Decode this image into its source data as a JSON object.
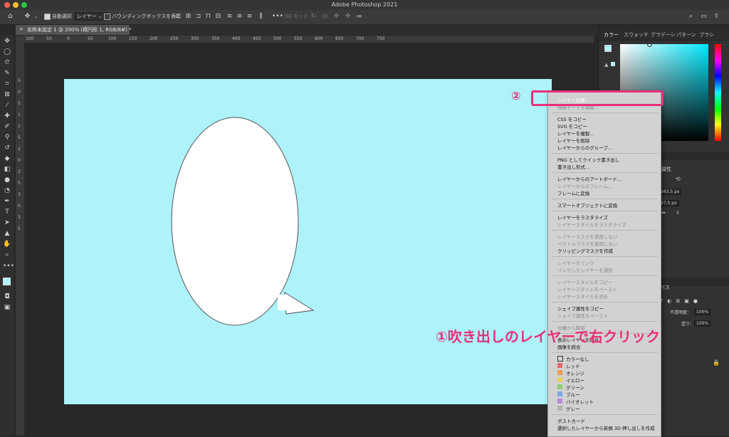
{
  "window": {
    "title": "Adobe Photoshop 2021"
  },
  "optionsbar": {
    "auto_select_label": "自動選択 :",
    "auto_select_value": "レイヤー",
    "bbox_label": "バウンディングボックスを表示",
    "mode3d_label": "3D モード :"
  },
  "document_tab": {
    "title": "名称未設定 1 @ 200% (楕円形 1, RGB/8#) *",
    "close": "×"
  },
  "ruler": {
    "h_ticks": [
      "100",
      "50",
      "0",
      "50",
      "100",
      "150",
      "200",
      "250",
      "300",
      "350",
      "400",
      "450",
      "500",
      "550",
      "600",
      "650",
      "700",
      "750"
    ],
    "v_ticks": [
      "5",
      "0",
      "5",
      "1",
      "1",
      "5",
      "2",
      "0",
      "2",
      "5",
      "3",
      "0",
      "3",
      "5"
    ]
  },
  "panels": {
    "color_tabs": [
      "カラー",
      "スウォッチ",
      "グラデーシ",
      "パターン",
      "ブラシ"
    ],
    "properties_label": "属性",
    "width_value": "263.5 px",
    "height_value": "97.5 px",
    "layers_label": "バス",
    "opacity_label": "不透明度：",
    "opacity_value": "100%",
    "fill_label": "塗り：",
    "fill_value": "100%"
  },
  "context_menu": {
    "items": [
      {
        "label": "レイヤー効果...",
        "disabled": false,
        "highlighted": true
      },
      {
        "label": "描画モードを編集...",
        "disabled": true
      },
      {
        "sep": true
      },
      {
        "label": "CSS をコピー",
        "disabled": false
      },
      {
        "label": "SVG をコピー",
        "disabled": false
      },
      {
        "label": "レイヤーを複製...",
        "disabled": false
      },
      {
        "label": "レイヤーを削除",
        "disabled": false
      },
      {
        "label": "レイヤーからのグループ...",
        "disabled": false
      },
      {
        "sep": true
      },
      {
        "label": "PNG としてクイック書き出し",
        "disabled": false
      },
      {
        "label": "書き出し形式...",
        "disabled": false
      },
      {
        "sep": true
      },
      {
        "label": "レイヤーからのアートボード...",
        "disabled": false
      },
      {
        "label": "レイヤーからのフレーム...",
        "disabled": true
      },
      {
        "label": "フレームに変換",
        "disabled": false
      },
      {
        "sep": true
      },
      {
        "label": "スマートオブジェクトに変換",
        "disabled": false
      },
      {
        "sep": true
      },
      {
        "label": "レイヤーをラスタライズ",
        "disabled": false
      },
      {
        "label": "レイヤースタイルをラスタライズ",
        "disabled": true
      },
      {
        "sep": true
      },
      {
        "label": "レイヤーマスクを使用しない",
        "disabled": true
      },
      {
        "label": "ベクトルマスクを使用しない",
        "disabled": true
      },
      {
        "label": "クリッピングマスクを作成",
        "disabled": false
      },
      {
        "sep": true
      },
      {
        "label": "レイヤーをリンク",
        "disabled": true
      },
      {
        "label": "リンクしたレイヤーを選択",
        "disabled": true
      },
      {
        "sep": true
      },
      {
        "label": "レイヤースタイルをコピー",
        "disabled": true
      },
      {
        "label": "レイヤースタイルをペースト",
        "disabled": true
      },
      {
        "label": "レイヤースタイルを消去",
        "disabled": true
      },
      {
        "sep": true
      },
      {
        "label": "シェイプ属性をコピー",
        "disabled": false
      },
      {
        "label": "シェイプ属性をペースト",
        "disabled": true
      },
      {
        "sep": true
      },
      {
        "label": "分離から解除",
        "disabled": true
      },
      {
        "sep": true
      },
      {
        "label": "表示レイヤーを結合",
        "disabled": false
      },
      {
        "label": "画像を統合",
        "disabled": false
      },
      {
        "sep": true
      },
      {
        "label": "カラーなし",
        "disabled": false,
        "swatch": "x"
      },
      {
        "label": "レッド",
        "disabled": false,
        "swatch": "#e46a6a"
      },
      {
        "label": "オレンジ",
        "disabled": false,
        "swatch": "#e9a15a"
      },
      {
        "label": "イエロー",
        "disabled": false,
        "swatch": "#e3d35b"
      },
      {
        "label": "グリーン",
        "disabled": false,
        "swatch": "#8fcf72"
      },
      {
        "label": "ブルー",
        "disabled": false,
        "swatch": "#7ea8e6"
      },
      {
        "label": "バイオレット",
        "disabled": false,
        "swatch": "#b58ad9"
      },
      {
        "label": "グレー",
        "disabled": false,
        "swatch": "#b4b4b4"
      },
      {
        "sep": true
      },
      {
        "label": "ポストカード",
        "disabled": false
      },
      {
        "label": "選択したレイヤーから新規 3D 押し出しを作成",
        "disabled": false
      }
    ]
  },
  "annotations": {
    "step2": "②",
    "step1": "①吹き出しのレイヤーで右クリック",
    "color": "#e8307a"
  },
  "colors": {
    "canvas": "#aef2fa",
    "menu_highlight": "#1f5fd6"
  }
}
